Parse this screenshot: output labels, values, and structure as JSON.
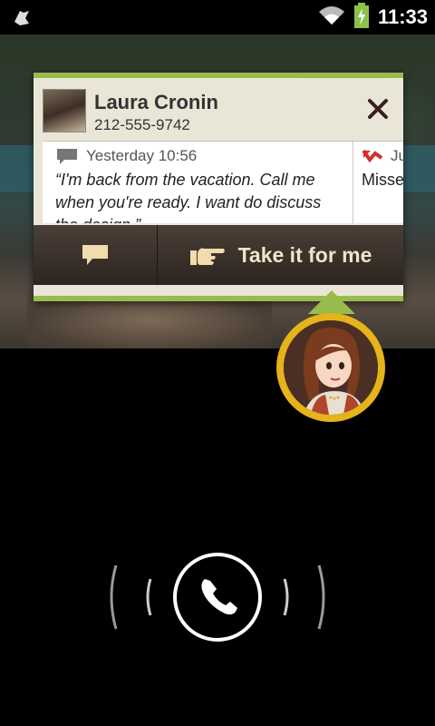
{
  "status_bar": {
    "time": "11:33",
    "notification_icon": "ghost-icon",
    "wifi_icon": "wifi-icon",
    "battery_icon": "battery-charging-icon",
    "battery_color": "#8bc34a"
  },
  "caller_card": {
    "name": "Laura Cronin",
    "phone": "212-555-9742",
    "accent_color": "#98bb4c",
    "messages": [
      {
        "icon": "speech-bubble-icon",
        "timestamp": "Yesterday 10:56",
        "text": "“I'm back from the vacation. Call me when you're ready. I want do discuss the design.”"
      },
      {
        "icon": "missed-call-icon",
        "timestamp": "Ju",
        "text": "Misse"
      }
    ],
    "actions": {
      "reply_icon": "chat-bubble-icon",
      "take_it_label": "Take it for me",
      "take_it_icon": "pointing-hand-icon"
    }
  },
  "assistant_avatar": {
    "icon": "assistant-avatar-icon",
    "ring_color": "#e5b31a"
  },
  "answer_control": {
    "icon": "phone-handset-icon"
  }
}
